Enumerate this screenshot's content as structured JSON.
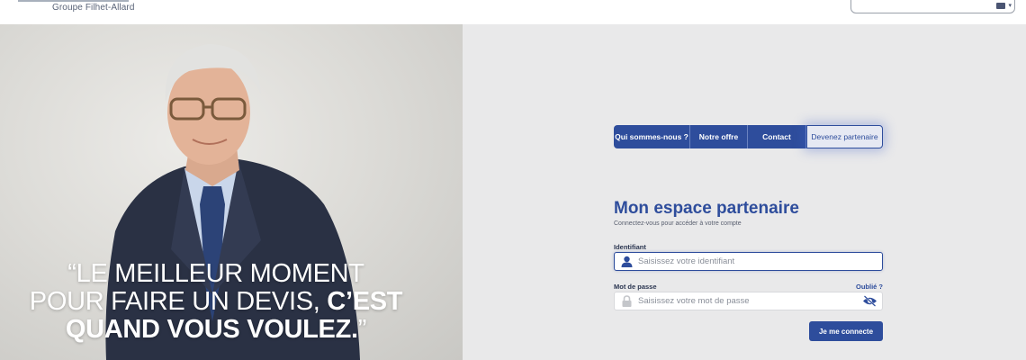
{
  "header": {
    "tagline": "Groupe Filhet-Allard"
  },
  "hero": {
    "quote_line1": "“LE MEILLEUR MOMENT",
    "quote_line2_light": "POUR FAIRE UN DEVIS, ",
    "quote_line2_bold": "C’EST",
    "quote_line3_bold": "QUAND VOUS VOULEZ.",
    "quote_line3_close": "”"
  },
  "nav": {
    "items": [
      {
        "label": "Qui sommes-nous ?"
      },
      {
        "label": "Notre offre"
      },
      {
        "label": "Contact"
      },
      {
        "label": "Devenez partenaire"
      }
    ]
  },
  "login": {
    "title": "Mon espace partenaire",
    "subtitle": "Connectez-vous pour accéder à votre compte",
    "id_label": "Identifiant",
    "id_placeholder": "Saisissez votre identifiant",
    "pw_label": "Mot de passe",
    "forgot": "Oublié ?",
    "pw_placeholder": "Saisissez votre mot de passe",
    "submit": "Je me connecte"
  },
  "icons": {
    "user": "user-icon",
    "lock": "lock-icon",
    "eye_slash": "eye-slash-icon"
  },
  "colors": {
    "brand_blue": "#2e4d9c",
    "panel_bg": "#e9e9ea",
    "hero_bg": "#dddcd8"
  }
}
